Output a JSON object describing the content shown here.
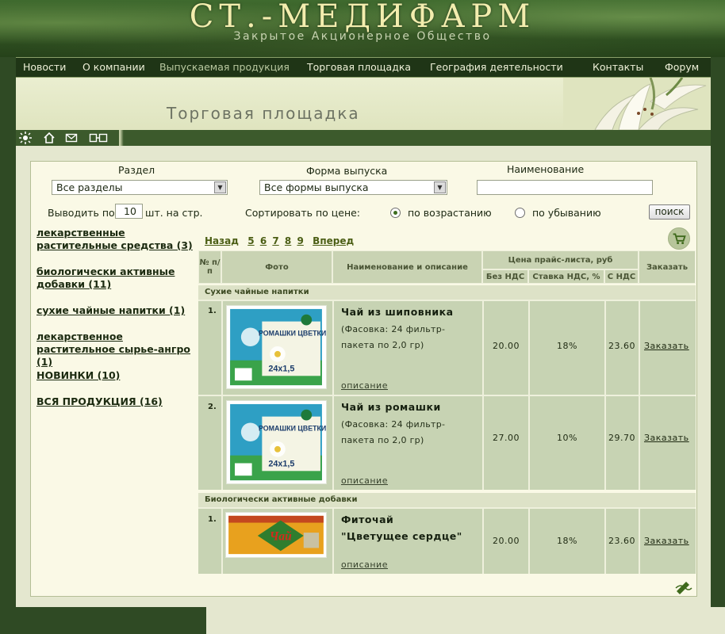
{
  "brand": {
    "title": "СТ.-МЕДИФАРМ",
    "subtitle": "Закрытое Акционерное Общество"
  },
  "nav": [
    "Новости",
    "О компании",
    "Выпускаемая продукция",
    "Торговая площадка",
    "География деятельности",
    "Контакты",
    "Форум"
  ],
  "page_title": "Торговая площадка",
  "filters": {
    "section_label": "Раздел",
    "section_value": "Все разделы",
    "form_label": "Форма выпуска",
    "form_value": "Все формы выпуска",
    "name_label": "Наименование",
    "name_value": "",
    "per_page_prefix": "Выводить по",
    "per_page_value": "10",
    "per_page_suffix": "шт. на стр.",
    "sort_label": "Сортировать по цене:",
    "sort_asc": "по возрастанию",
    "sort_desc": "по убыванию",
    "search_button": "поиск"
  },
  "sidebar": [
    "лекарственные растительные средства (3)",
    "биологически активные добавки (11)",
    "сухие чайные напитки (1)",
    "лекарственное растительное сырье-ангро (1)",
    "НОВИНКИ (10)",
    "ВСЯ ПРОДУКЦИЯ (16)"
  ],
  "pager": {
    "prev": "Назад",
    "pages": [
      "5",
      "6",
      "7",
      "8",
      "9"
    ],
    "next": "Вперед"
  },
  "table": {
    "col_num": "№ п/п",
    "col_photo": "Фото",
    "col_name": "Наименование и описание",
    "col_price_group": "Цена прайс-листа, руб",
    "col_no_vat": "Без НДС",
    "col_vat_rate": "Ставка НДС, %",
    "col_with_vat": "С НДС",
    "col_order": "Заказать"
  },
  "groups": [
    {
      "title": "Сухие чайные напитки",
      "items": [
        {
          "num": "1.",
          "name": "Чай из шиповника",
          "pack": "(Фасовка: 24 фильтр-пакета по 2,0 гр)",
          "desc": "описание",
          "price": "20.00",
          "vat": "18%",
          "total": "23.60",
          "order": "Заказать",
          "box_title": "РОМАШКИ ЦВЕТКИ",
          "box_count": "24x1,5"
        },
        {
          "num": "2.",
          "name": "Чай из ромашки",
          "pack": "(Фасовка: 24 фильтр-пакета по 2,0 гр)",
          "desc": "описание",
          "price": "27.00",
          "vat": "10%",
          "total": "29.70",
          "order": "Заказать",
          "box_title": "РОМАШКИ ЦВЕТКИ",
          "box_count": "24x1,5"
        }
      ]
    },
    {
      "title": "Биологически активные добавки",
      "items": [
        {
          "num": "1.",
          "name": "Фиточай",
          "name2": "\"Цветущее сердце\"",
          "desc": "описание",
          "price": "20.00",
          "vat": "18%",
          "total": "23.60",
          "order": "Заказать",
          "box_title": "Чай"
        }
      ]
    }
  ]
}
